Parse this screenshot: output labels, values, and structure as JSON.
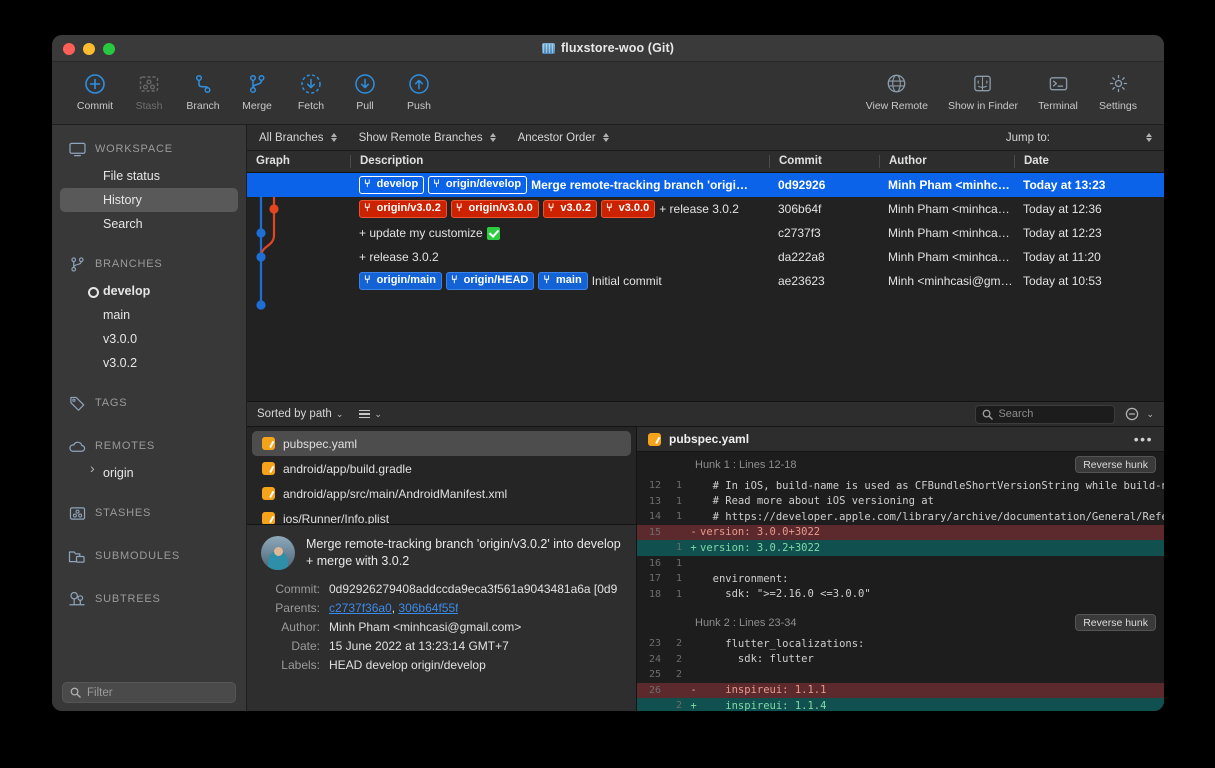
{
  "window": {
    "title": "fluxstore-woo (Git)"
  },
  "toolbar": {
    "left": [
      {
        "label": "Commit",
        "icon": "commit-plus-icon",
        "dim": false
      },
      {
        "label": "Stash",
        "icon": "stash-icon",
        "dim": true
      },
      {
        "label": "Branch",
        "icon": "branch-icon",
        "dim": false
      },
      {
        "label": "Merge",
        "icon": "merge-icon",
        "dim": false
      },
      {
        "label": "Fetch",
        "icon": "fetch-down-dashed-icon",
        "dim": false
      },
      {
        "label": "Pull",
        "icon": "pull-down-icon",
        "dim": false
      },
      {
        "label": "Push",
        "icon": "push-up-icon",
        "dim": false
      }
    ],
    "right": [
      {
        "label": "View Remote",
        "icon": "globe-icon"
      },
      {
        "label": "Show in Finder",
        "icon": "finder-icon"
      },
      {
        "label": "Terminal",
        "icon": "terminal-icon"
      },
      {
        "label": "Settings",
        "icon": "gear-icon"
      }
    ]
  },
  "sidebar": {
    "sections": [
      {
        "title": "WORKSPACE",
        "icon": "monitor-icon",
        "items": [
          {
            "label": "File status",
            "selected": false
          },
          {
            "label": "History",
            "selected": true
          },
          {
            "label": "Search",
            "selected": false
          }
        ]
      },
      {
        "title": "BRANCHES",
        "icon": "branch-icon",
        "items": [
          {
            "label": "develop",
            "current": true
          },
          {
            "label": "main",
            "current": false
          },
          {
            "label": "v3.0.0",
            "current": false
          },
          {
            "label": "v3.0.2",
            "current": false
          }
        ]
      },
      {
        "title": "TAGS",
        "icon": "tag-icon",
        "items": []
      },
      {
        "title": "REMOTES",
        "icon": "cloud-icon",
        "items": [
          {
            "label": "origin",
            "expandable": true
          }
        ]
      },
      {
        "title": "STASHES",
        "icon": "stash-icon",
        "items": []
      },
      {
        "title": "SUBMODULES",
        "icon": "submodule-icon",
        "items": []
      },
      {
        "title": "SUBTREES",
        "icon": "subtree-icon",
        "items": []
      }
    ],
    "filter": {
      "placeholder": "Filter",
      "icon": "search-icon"
    }
  },
  "history": {
    "filters": [
      {
        "label": "All Branches"
      },
      {
        "label": "Show Remote Branches"
      },
      {
        "label": "Ancestor Order"
      }
    ],
    "jump_to_label": "Jump to:",
    "columns": [
      "Graph",
      "Description",
      "Commit",
      "Author",
      "Date"
    ],
    "rows": [
      {
        "badges": [
          {
            "text": "develop",
            "kind": "onsel"
          },
          {
            "text": "origin/develop",
            "kind": "onsel"
          }
        ],
        "description": "Merge remote-tracking branch 'origi…",
        "commit": "0d92926",
        "author": "Minh Pham <minhcasi…",
        "date": "Today at 13:23",
        "selected": true,
        "check": false
      },
      {
        "badges": [
          {
            "text": "origin/v3.0.2",
            "kind": "red"
          },
          {
            "text": "origin/v3.0.0",
            "kind": "red"
          },
          {
            "text": "v3.0.2",
            "kind": "red"
          },
          {
            "text": "v3.0.0",
            "kind": "red"
          }
        ],
        "description": "+ release 3.0.2",
        "commit": "306b64f",
        "author": "Minh Pham <minhcasi@…",
        "date": "Today at 12:36",
        "selected": false,
        "check": false
      },
      {
        "badges": [],
        "description": "+ update my customize",
        "commit": "c2737f3",
        "author": "Minh Pham <minhcasi@…",
        "date": "Today at 12:23",
        "selected": false,
        "check": true
      },
      {
        "badges": [],
        "description": "+ release 3.0.2",
        "commit": "da222a8",
        "author": "Minh Pham <minhcasi@…",
        "date": "Today at 11:20",
        "selected": false,
        "check": false
      },
      {
        "badges": [
          {
            "text": "origin/main",
            "kind": "blue"
          },
          {
            "text": "origin/HEAD",
            "kind": "blue"
          },
          {
            "text": "main",
            "kind": "blue"
          }
        ],
        "description": "Initial commit",
        "commit": "ae23623",
        "author": "Minh <minhcasi@gmail.…",
        "date": "Today at 10:53",
        "selected": false,
        "check": false
      }
    ]
  },
  "filebar": {
    "sort_label": "Sorted by path",
    "search_placeholder": "Search",
    "search_icon": "search-icon",
    "list_icon": "list-view-icon",
    "zoom_icon": "zoom-out-icon"
  },
  "files": [
    {
      "name": "pubspec.yaml",
      "status": "modified",
      "selected": true
    },
    {
      "name": "android/app/build.gradle",
      "status": "modified",
      "selected": false
    },
    {
      "name": "android/app/src/main/AndroidManifest.xml",
      "status": "modified",
      "selected": false
    },
    {
      "name": "ios/Runner/Info.plist",
      "status": "modified",
      "selected": false
    }
  ],
  "commit_detail": {
    "message_line1": "Merge remote-tracking branch 'origin/v3.0.2' into develop",
    "message_line2": "+ merge with 3.0.2",
    "labels": {
      "commit": "Commit:",
      "parents": "Parents:",
      "author": "Author:",
      "date": "Date:",
      "labels": "Labels:"
    },
    "commit_hash": "0d92926279408addccda9eca3f561a9043481a6a [0d9",
    "parents": [
      "c2737f36a0",
      "306b64f55f"
    ],
    "parents_separator": ", ",
    "author": "Minh Pham <minhcasi@gmail.com>",
    "date": "15 June 2022 at 13:23:14 GMT+7",
    "labels_value": "HEAD develop origin/develop"
  },
  "diff": {
    "file_name": "pubspec.yaml",
    "menu_icon": "more-dots-icon",
    "hunks": [
      {
        "title": "Hunk 1 : Lines 12-18",
        "reverse_label": "Reverse hunk",
        "lines": [
          {
            "old": "12",
            "new": "1",
            "sign": "",
            "text": "  # In iOS, build-name is used as CFBundleShortVersionString while build-number us",
            "type": "ctx"
          },
          {
            "old": "13",
            "new": "1",
            "sign": "",
            "text": "  # Read more about iOS versioning at",
            "type": "ctx"
          },
          {
            "old": "14",
            "new": "1",
            "sign": "",
            "text": "  # https://developer.apple.com/library/archive/documentation/General/Reference/In",
            "type": "ctx"
          },
          {
            "old": "15",
            "new": "",
            "sign": "-",
            "text": "version: 3.0.0+3022",
            "type": "del"
          },
          {
            "old": "",
            "new": "1",
            "sign": "+",
            "text": "version: 3.0.2+3022",
            "type": "add"
          },
          {
            "old": "16",
            "new": "1",
            "sign": "",
            "text": "",
            "type": "ctx"
          },
          {
            "old": "17",
            "new": "1",
            "sign": "",
            "text": "  environment:",
            "type": "ctx"
          },
          {
            "old": "18",
            "new": "1",
            "sign": "",
            "text": "    sdk: \">=2.16.0 <=3.0.0\"",
            "type": "ctx"
          }
        ]
      },
      {
        "title": "Hunk 2 : Lines 23-34",
        "reverse_label": "Reverse hunk",
        "lines": [
          {
            "old": "23",
            "new": "2",
            "sign": "",
            "text": "    flutter_localizations:",
            "type": "ctx"
          },
          {
            "old": "24",
            "new": "2",
            "sign": "",
            "text": "      sdk: flutter",
            "type": "ctx"
          },
          {
            "old": "25",
            "new": "2",
            "sign": "",
            "text": "",
            "type": "ctx"
          },
          {
            "old": "26",
            "new": "",
            "sign": "-",
            "text": "    inspireui: 1.1.1",
            "type": "del"
          },
          {
            "old": "",
            "new": "2",
            "sign": "+",
            "text": "    inspireui: 1.1.4",
            "type": "add"
          }
        ]
      }
    ]
  },
  "colors": {
    "accent_blue": "#0a63e8",
    "tag_red": "#cc2200",
    "branch_blue": "#1463d6",
    "add_green": "#10504f",
    "del_red": "#5c2a2c",
    "file_orange": "#f5a31a",
    "icon_blue": "#4a90d9"
  }
}
